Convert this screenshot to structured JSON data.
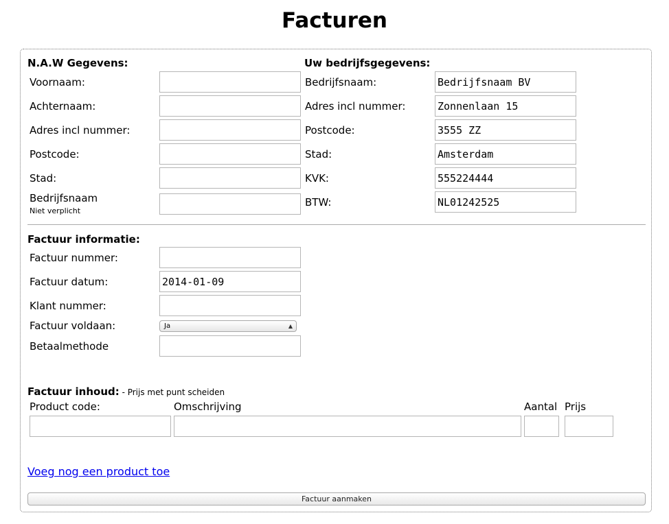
{
  "page": {
    "title": "Facturen"
  },
  "naw": {
    "title": "N.A.W Gegevens:",
    "fields": [
      {
        "label": "Voornaam:",
        "value": ""
      },
      {
        "label": "Achternaam:",
        "value": ""
      },
      {
        "label": "Adres incl nummer:",
        "value": ""
      },
      {
        "label": "Postcode:",
        "value": ""
      },
      {
        "label": "Stad:",
        "value": ""
      },
      {
        "label": "Bedrijfsnaam",
        "sublabel": "Niet verplicht",
        "value": ""
      }
    ]
  },
  "company": {
    "title": "Uw bedrijfsgegevens:",
    "fields": [
      {
        "label": "Bedrijfsnaam:",
        "value": "Bedrijfsnaam BV"
      },
      {
        "label": "Adres incl nummer:",
        "value": "Zonnenlaan 15"
      },
      {
        "label": "Postcode:",
        "value": "3555 ZZ"
      },
      {
        "label": "Stad:",
        "value": "Amsterdam"
      },
      {
        "label": "KVK:",
        "value": "555224444"
      },
      {
        "label": "BTW:",
        "value": "NL01242525"
      }
    ]
  },
  "invoice": {
    "title": "Factuur informatie:",
    "fields": [
      {
        "label": "Factuur nummer:",
        "value": ""
      },
      {
        "label": "Factuur datum:",
        "value": "2014-01-09"
      },
      {
        "label": "Klant nummer:",
        "value": ""
      },
      {
        "label": "Factuur voldaan:",
        "value": "Ja"
      },
      {
        "label": "Betaalmethode",
        "value": ""
      }
    ]
  },
  "contents": {
    "title": "Factuur inhoud:",
    "note": " - Prijs met punt scheiden",
    "columns": {
      "product_code": "Product code:",
      "description": "Omschrijving",
      "quantity": "Aantal",
      "price": "Prijs"
    },
    "row": {
      "product_code": "",
      "description": "",
      "quantity": "",
      "price": ""
    },
    "add_product_link": "Voeg nog een product toe",
    "submit_label": "Factuur aanmaken"
  }
}
